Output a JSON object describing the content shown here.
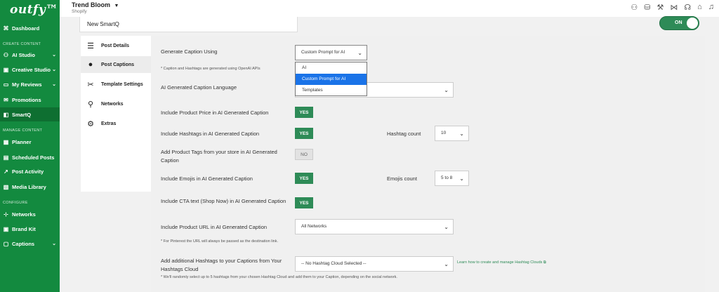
{
  "sidebar": {
    "logo": "outfy™",
    "sections": {
      "create": "CREATE CONTENT",
      "manage": "MANAGE CONTENT",
      "configure": "CONFIGURE"
    },
    "items": [
      {
        "label": "Dashboard",
        "icon": "dashboard-icon"
      },
      {
        "label": "AI Studio",
        "icon": "ai-icon",
        "has_chevron": true
      },
      {
        "label": "Creative Studio",
        "icon": "creative-icon",
        "has_chevron": true
      },
      {
        "label": "My Reviews",
        "icon": "reviews-icon",
        "has_chevron": true
      },
      {
        "label": "Promotions",
        "icon": "promotions-icon"
      },
      {
        "label": "SmartQ",
        "icon": "smartq-icon",
        "active": true
      },
      {
        "label": "Planner",
        "icon": "planner-icon"
      },
      {
        "label": "Scheduled Posts",
        "icon": "scheduled-icon"
      },
      {
        "label": "Post Activity",
        "icon": "activity-icon"
      },
      {
        "label": "Media Library",
        "icon": "media-icon"
      },
      {
        "label": "Networks",
        "icon": "networks-icon"
      },
      {
        "label": "Brand Kit",
        "icon": "brandkit-icon"
      },
      {
        "label": "Captions",
        "icon": "captions-icon",
        "has_chevron": true
      }
    ]
  },
  "topbar": {
    "shop_name": "Trend Bloom",
    "shop_platform": "Shopify"
  },
  "smartq": {
    "name": "New SmartQ",
    "toggle_label": "ON"
  },
  "tabs": [
    {
      "label": "Post Details",
      "icon": "sliders-icon"
    },
    {
      "label": "Post Captions",
      "icon": "chat-icon",
      "active": true
    },
    {
      "label": "Template Settings",
      "icon": "tools-icon"
    },
    {
      "label": "Networks",
      "icon": "network-icon"
    },
    {
      "label": "Extras",
      "icon": "gear-icon"
    }
  ],
  "form": {
    "generate_caption_label": "Generate Caption Using",
    "generate_caption_value": "Custom Prompt for AI",
    "generate_caption_options": [
      "AI",
      "Custom Prompt for AI",
      "Templates"
    ],
    "openai_note": "* Caption and Hashtags are generated using OpenAI APIs",
    "language_label": "AI Generated Caption Language",
    "price_label": "Include Product Price in AI Generated Caption",
    "price_value": "YES",
    "hashtags_label": "Include Hashtags in AI Generated Caption",
    "hashtags_value": "YES",
    "hashtag_count_label": "Hashtag count",
    "hashtag_count_value": "10",
    "tags_label": "Add Product Tags from your store in AI Generated Caption",
    "tags_value": "NO",
    "emojis_label": "Include Emojis in AI Generated Caption",
    "emojis_value": "YES",
    "emojis_count_label": "Emojis count",
    "emojis_count_value": "5 to 8",
    "cta_label": "Include CTA text (Shop Now) in AI Generated Caption",
    "cta_value": "YES",
    "url_label": "Include Product URL in AI Generated Caption",
    "url_value": "All Networks",
    "pinterest_note": "* For Pinterest the URL will always be passed as the destination link.",
    "hashtag_cloud_label": "Add additional Hashtags to your Captions from Your Hashtags Cloud",
    "hashtag_cloud_value": "-- No Hashtag Cloud Selected --",
    "hashtag_cloud_link": "Learn how to create and manage Hashtag Clouds",
    "random_note": "* We'll randomly select up to 5 hashtags from your chosen Hashtag Cloud and add them to your Caption, depending on the social network."
  },
  "colors": {
    "brand_green": "#138a3f",
    "toggle_green": "#2e8b57",
    "highlight_blue": "#1a73e8"
  }
}
